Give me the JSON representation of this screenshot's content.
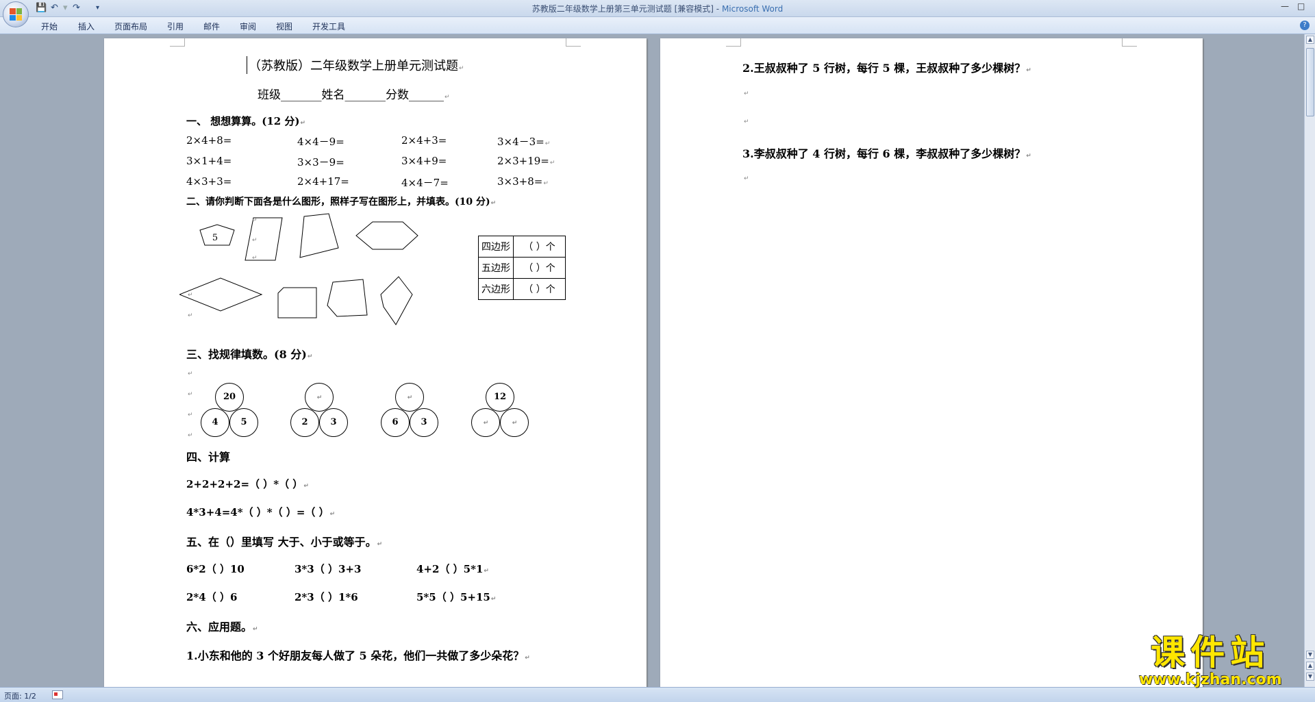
{
  "window": {
    "title": "苏教版二年级数学上册第三单元测试题 [兼容模式]",
    "app_name": "Microsoft Word"
  },
  "ribbon": {
    "tabs": [
      "开始",
      "插入",
      "页面布局",
      "引用",
      "邮件",
      "审阅",
      "视图",
      "开发工具"
    ]
  },
  "page1": {
    "title": "（苏教版）二年级数学上册单元测试题",
    "info": "班级_______姓名_______分数______",
    "s1": {
      "heading": "一、  想想算算。(12 分)",
      "rows": [
        [
          "2×4+8=",
          "4×4－9=",
          "2×4+3=",
          "3×4－3="
        ],
        [
          "3×1+4=",
          "3×3－9=",
          "3×4+9=",
          "2×3+19="
        ],
        [
          "4×3+3=",
          "2×4+17=",
          "4×4－7=",
          "3×3+8="
        ]
      ]
    },
    "s2": {
      "heading": "二、请你判断下面各是什么图形，照样子写在图形上，并填表。(10 分)",
      "pentagon_label": "5",
      "table": [
        {
          "name": "四边形",
          "value": "（    ）个"
        },
        {
          "name": "五边形",
          "value": "（    ）个"
        },
        {
          "name": "六边形",
          "value": "（    ）个"
        }
      ]
    },
    "s3": {
      "heading": "三、找规律填数。(8 分)",
      "groups": [
        {
          "top": "20",
          "left": "4",
          "right": "5"
        },
        {
          "top": "",
          "left": "2",
          "right": "3"
        },
        {
          "top": "",
          "left": "6",
          "right": "3"
        },
        {
          "top": "12",
          "left": "",
          "right": ""
        }
      ]
    },
    "s4": {
      "heading": "四、计算",
      "line1": "2+2+2+2=（  ）*（  ）",
      "line2": "4*3+4=4*（  ）*（  ）=（  ）"
    },
    "s5": {
      "heading": "五、在（）里填写 大于、小于或等于。",
      "rows": [
        [
          "6*2（   ）10",
          "3*3（   ）3+3",
          "4+2（   ）5*1"
        ],
        [
          "2*4（   ）6",
          "2*3（   ）1*6",
          "5*5（   ）5+15"
        ]
      ]
    },
    "s6": {
      "heading": "六、应用题。",
      "q1": "1.小东和他的 3 个好朋友每人做了 5 朵花，他们一共做了多少朵花？"
    }
  },
  "page2": {
    "q2": "2.王叔叔种了 5 行树，每行 5 棵，王叔叔种了多少棵树？",
    "q3": "3.李叔叔种了 4 行树，每行 6 棵，李叔叔种了多少棵树？"
  },
  "status": {
    "page": "页面: 1/2"
  },
  "watermark": {
    "big": "课件站",
    "small": "www.kjzhan.com"
  }
}
